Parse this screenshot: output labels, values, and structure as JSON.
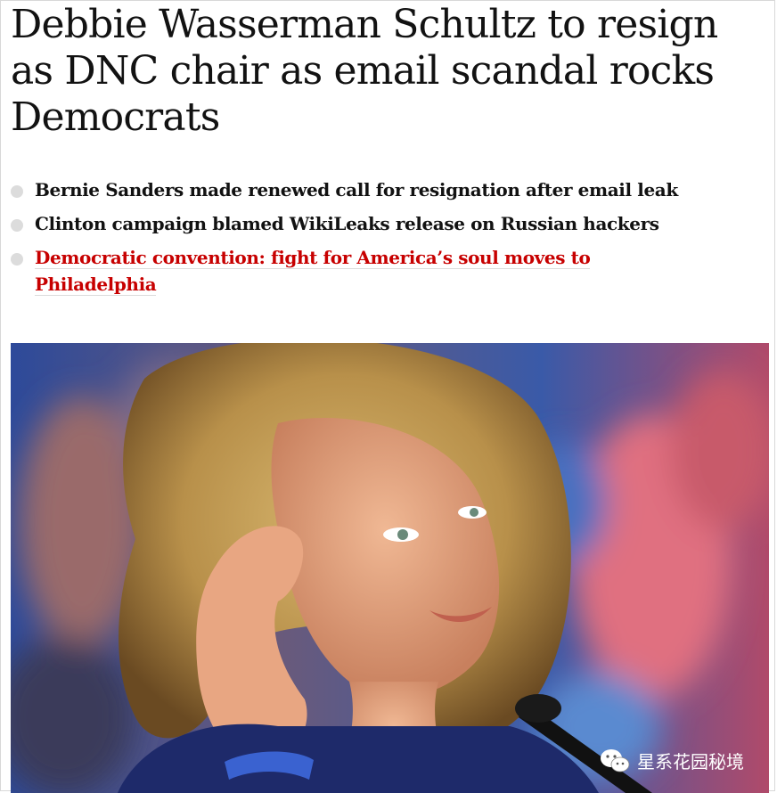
{
  "article": {
    "headline": "Debbie Wasserman Schultz to resign as DNC chair as email scandal rocks Democrats",
    "bullets": [
      {
        "text": "Bernie Sanders made renewed call for resignation after email leak",
        "is_link": false
      },
      {
        "text": "Clinton campaign blamed WikiLeaks release on Russian hackers",
        "is_link": false
      },
      {
        "text": "Democratic convention: fight for America’s soul moves to Philadelphia",
        "is_link": true
      }
    ]
  },
  "watermark": {
    "label": "星系花园秘境",
    "icon": "wechat-icon"
  },
  "colors": {
    "headline": "#121212",
    "link": "#c70000",
    "bullet_dot": "#dcdcdc"
  }
}
